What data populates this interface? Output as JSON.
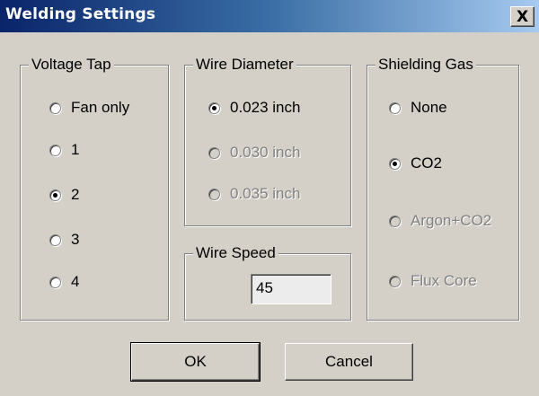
{
  "window": {
    "title": "Welding Settings",
    "close_glyph": "X"
  },
  "voltage_tap": {
    "legend": "Voltage Tap",
    "options": [
      {
        "label": "Fan only",
        "checked": false,
        "enabled": true
      },
      {
        "label": "1",
        "checked": false,
        "enabled": true
      },
      {
        "label": "2",
        "checked": true,
        "enabled": true
      },
      {
        "label": "3",
        "checked": false,
        "enabled": true
      },
      {
        "label": "4",
        "checked": false,
        "enabled": true
      }
    ]
  },
  "wire_diameter": {
    "legend": "Wire Diameter",
    "options": [
      {
        "label": "0.023 inch",
        "checked": true,
        "enabled": true
      },
      {
        "label": "0.030 inch",
        "checked": false,
        "enabled": false
      },
      {
        "label": "0.035 inch",
        "checked": false,
        "enabled": false
      }
    ]
  },
  "wire_speed": {
    "legend": "Wire Speed",
    "value": "45"
  },
  "shielding_gas": {
    "legend": "Shielding Gas",
    "options": [
      {
        "label": "None",
        "checked": false,
        "enabled": true
      },
      {
        "label": "CO2",
        "checked": true,
        "enabled": true
      },
      {
        "label": "Argon+CO2",
        "checked": false,
        "enabled": false
      },
      {
        "label": "Flux Core",
        "checked": false,
        "enabled": false
      }
    ]
  },
  "buttons": {
    "ok": "OK",
    "cancel": "Cancel"
  }
}
